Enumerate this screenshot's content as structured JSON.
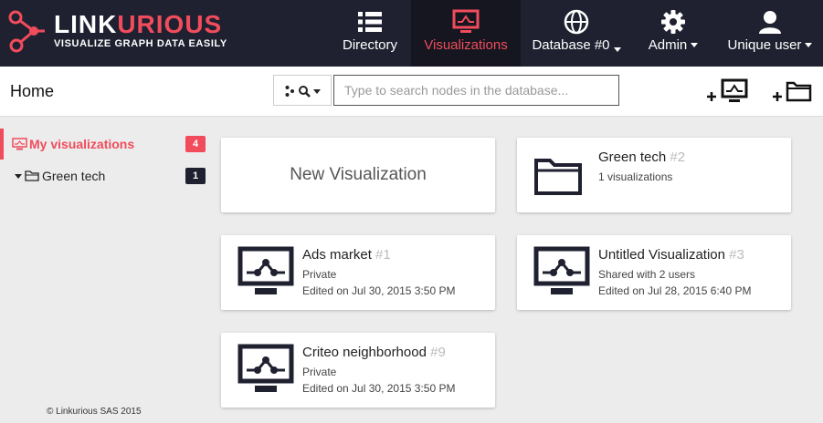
{
  "brand": {
    "name_light": "LINK",
    "name_accent": "URIOUS",
    "tagline": "VISUALIZE GRAPH DATA EASILY"
  },
  "nav": {
    "directory": "Directory",
    "visualizations": "Visualizations",
    "database": "Database #0",
    "admin": "Admin",
    "user": "Unique user"
  },
  "header": {
    "title": "Home",
    "search_placeholder": "Type to search nodes in the database..."
  },
  "sidebar": {
    "items": [
      {
        "label": "My visualizations",
        "count": "4"
      },
      {
        "label": "Green tech",
        "count": "1"
      }
    ],
    "copyright": "© Linkurious SAS 2015"
  },
  "cards": {
    "new_label": "New Visualization",
    "folder": {
      "title": "Green tech",
      "num": "#2",
      "line1": "1 visualizations"
    },
    "items": [
      {
        "title": "Ads market",
        "num": "#1",
        "line1": "Private",
        "line2": "Edited on Jul 30, 2015 3:50 PM"
      },
      {
        "title": "Untitled Visualization",
        "num": "#3",
        "line1": "Shared with 2 users",
        "line2": "Edited on Jul 28, 2015 6:40 PM"
      },
      {
        "title": "Criteo neighborhood",
        "num": "#9",
        "line1": "Private",
        "line2": "Edited on Jul 30, 2015 3:50 PM"
      }
    ]
  },
  "colors": {
    "navbar": "#1f2130",
    "accent": "#f04c5c",
    "background": "#ececec"
  },
  "icons": {
    "logo": "linkurious-graph-logo",
    "directory": "list-icon",
    "visualizations": "monitor-graph-icon",
    "database": "globe-icon",
    "admin": "gear-icon",
    "user": "user-icon",
    "search_type": "graph-search-icon",
    "add_visualization": "add-visualization-icon",
    "add_folder": "add-folder-icon",
    "folder": "folder-icon",
    "visualization": "visualization-monitor-icon"
  }
}
